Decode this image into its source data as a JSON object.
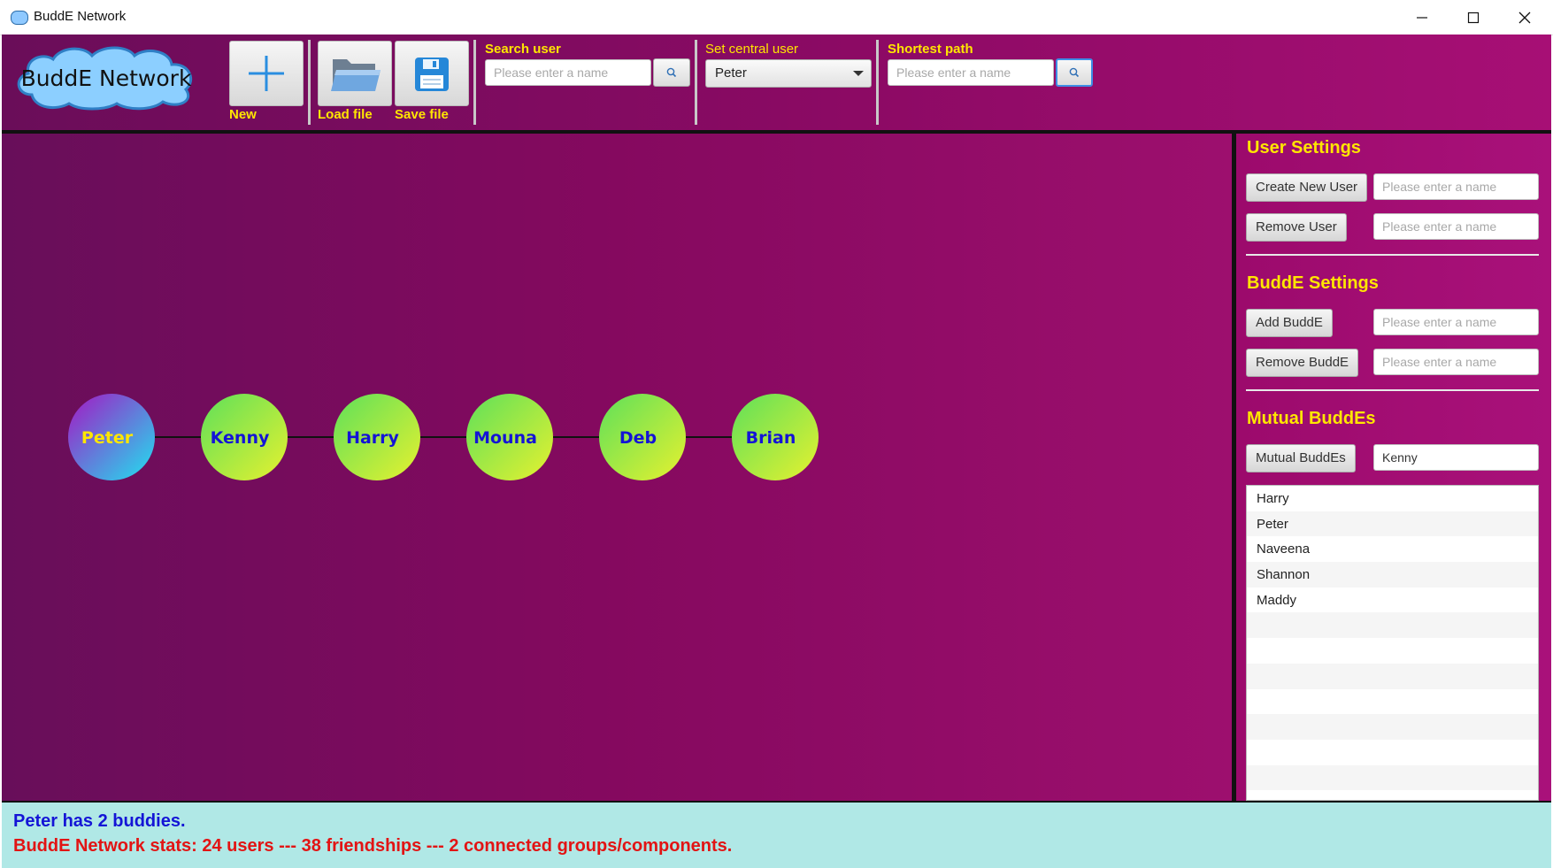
{
  "window": {
    "title": "BuddE Network"
  },
  "toolbar": {
    "logo_text": "BuddE Network",
    "new_label": "New",
    "load_label": "Load file",
    "save_label": "Save file",
    "search_user": {
      "label": "Search user",
      "placeholder": "Please enter a name"
    },
    "central_user": {
      "label": "Set central user",
      "selected": "Peter"
    },
    "shortest_path": {
      "label": "Shortest path",
      "placeholder": "Please enter a name"
    }
  },
  "graph": {
    "nodes": [
      "Peter",
      "Kenny",
      "Harry",
      "Mouna",
      "Deb",
      "Brian"
    ],
    "central": "Peter"
  },
  "settings": {
    "user_settings_title": "User Settings",
    "create_user_label": "Create New User",
    "remove_user_label": "Remove User",
    "budde_settings_title": "BuddE Settings",
    "add_budde_label": "Add BuddE",
    "remove_budde_label": "Remove BuddE",
    "mutual_title": "Mutual BuddEs",
    "mutual_button_label": "Mutual BuddEs",
    "mutual_input_value": "Kenny",
    "field_placeholder": "Please enter a name",
    "mutual_list": [
      "Harry",
      "Peter",
      "Naveena",
      "Shannon",
      "Maddy"
    ]
  },
  "status": {
    "line1": "Peter has 2 buddies.",
    "line2": "BuddE Network stats: 24 users --- 38 friendships --- 2 connected groups/components."
  },
  "colors": {
    "accent_yellow": "#ffe600",
    "node_label_blue": "#1414d6",
    "status_red": "#e21414"
  }
}
